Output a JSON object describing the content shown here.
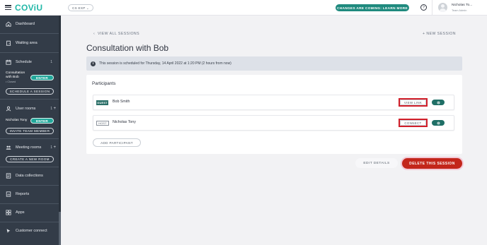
{
  "brand": "COViU",
  "topbar": {
    "environment": "CS EXP",
    "changes_button": "CHANGES ARE COMING: LEARN MORE",
    "help_glyph": "?",
    "user_name": "Nicholas To...",
    "user_role": "Team Admin"
  },
  "sidebar": {
    "dashboard": "Dashboard",
    "waiting_area": "Waiting area",
    "schedule": "Schedule",
    "schedule_count": "1",
    "session_title": "Consultation with Bob",
    "session_sub": "• Closed",
    "session_enter": "ENTER",
    "schedule_button": "SCHEDULE A SESSION",
    "user_rooms": "User rooms",
    "user_rooms_count": "1",
    "user_room_name": "Nicholas Tony",
    "user_room_enter": "ENTER",
    "invite_button": "INVITE TEAM MEMBER",
    "meeting_rooms": "Meeting rooms",
    "meeting_rooms_count": "1",
    "create_room_button": "CREATE A NEW ROOM",
    "data_collections": "Data collections",
    "reports": "Reports",
    "apps": "Apps",
    "customer_connect": "Customer connect"
  },
  "main": {
    "view_all": "VIEW ALL SESSIONS",
    "new_session": "NEW SESSION",
    "title": "Consultation with Bob",
    "info_icon_glyph": "i",
    "info_text": "This session is scheduled for Thursday, 14 April 2022 at 1:20 PM (2 hours from now)",
    "participants_title": "Participants",
    "participants": [
      {
        "badge": "GUEST",
        "name": "Bob Smith",
        "action": "VIEW LINK"
      },
      {
        "badge": "HOST",
        "name": "Nicholas Tony",
        "action": "CONNECT"
      }
    ],
    "add_participant": "ADD PARTICIPANT",
    "edit_details": "EDIT DETAILS",
    "delete_session": "DELETE THIS SESSION"
  },
  "colors": {
    "sidebar_bg": "#333c48",
    "brand": "#23b8a8",
    "accent_teal": "#1f8a7e",
    "delete_red": "#c3261b",
    "highlight_box": "#d11f2a"
  }
}
